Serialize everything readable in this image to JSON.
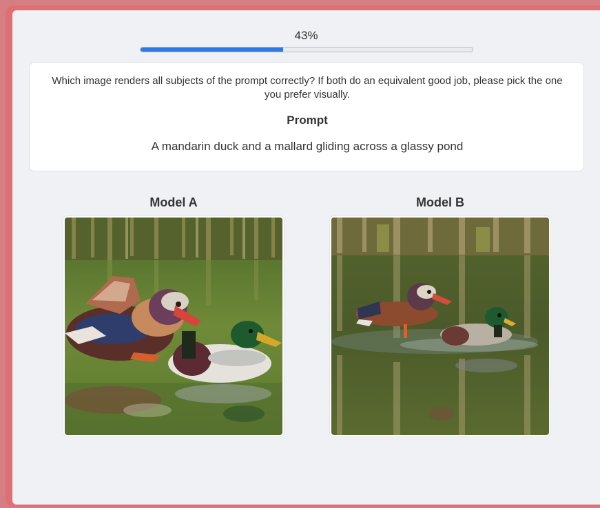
{
  "progress": {
    "label": "43%",
    "fraction": 0.43,
    "fill_color": "#2f78e8"
  },
  "question": {
    "text": "Which image renders all subjects of the prompt correctly? If both do an equivalent good job, please pick the one you prefer visually.",
    "prompt_heading": "Prompt",
    "prompt_text": "A mandarin duck and a mallard gliding across a glassy pond"
  },
  "models": [
    {
      "title": "Model A",
      "image_subject": "mandarin-duck-and-mallard-close-up"
    },
    {
      "title": "Model B",
      "image_subject": "mandarin-duck-and-mallard-wide"
    }
  ],
  "colors": {
    "frame": "#e06f74",
    "panel_bg": "#eff1f5",
    "card_bg": "#ffffff"
  }
}
